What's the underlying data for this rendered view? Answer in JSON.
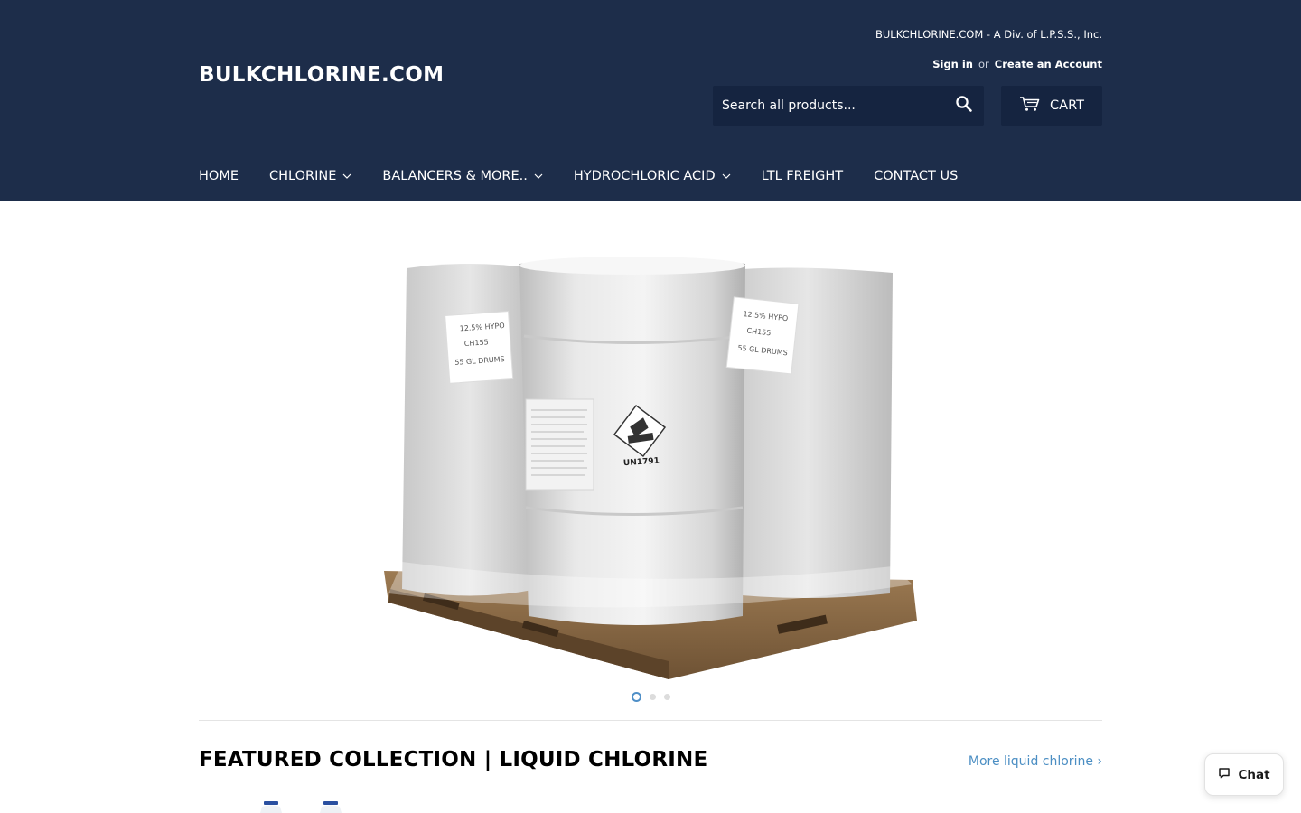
{
  "header": {
    "logo": "BULKCHLORINE.COM",
    "tagline": "BULKCHLORINE.COM - A Div. of L.P.S.S., Inc.",
    "sign_in": "Sign in",
    "or": "or",
    "create_account": "Create an Account",
    "search_placeholder": "Search all products...",
    "search_icon": "search-icon",
    "cart_label": "CART",
    "cart_icon": "cart-icon"
  },
  "nav": {
    "items": [
      {
        "label": "HOME",
        "has_dropdown": false
      },
      {
        "label": "CHLORINE",
        "has_dropdown": true
      },
      {
        "label": "BALANCERS & MORE..",
        "has_dropdown": true
      },
      {
        "label": "HYDROCHLORIC ACID",
        "has_dropdown": true
      },
      {
        "label": "LTL FREIGHT",
        "has_dropdown": false
      },
      {
        "label": "CONTACT US",
        "has_dropdown": false
      }
    ]
  },
  "hero": {
    "slide_count": 3,
    "active_slide": 1,
    "drum_labels": {
      "left": [
        "12.5% HYPO",
        "CH155",
        "55 GL DRUMS"
      ],
      "right": [
        "12.5% HYPO",
        "CH155",
        "55 GL DRUMS"
      ],
      "center": "UN1791"
    }
  },
  "featured": {
    "title": "FEATURED COLLECTION | LIQUID CHLORINE",
    "more_link": "More liquid chlorine ›"
  },
  "chat": {
    "label": "Chat",
    "icon": "chat-bubble-icon"
  },
  "colors": {
    "header_bg": "#1d2d4a",
    "search_bg": "#152440",
    "link": "#4b8ec3"
  }
}
